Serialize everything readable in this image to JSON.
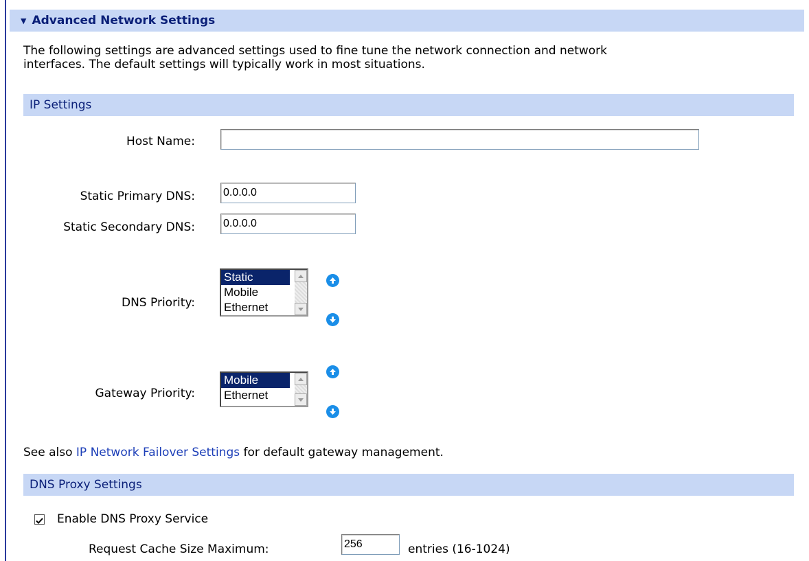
{
  "page": {
    "section_title": "Advanced Network Settings",
    "intro_line1": "The following settings are advanced settings used to fine tune the network connection and network",
    "intro_line2": "interfaces. The default settings will typically work in most situations."
  },
  "ip_settings": {
    "header": "IP Settings",
    "host_name_label": "Host Name:",
    "host_name_value": "",
    "primary_dns_label": "Static Primary DNS:",
    "primary_dns_value": "0.0.0.0",
    "secondary_dns_label": "Static Secondary DNS:",
    "secondary_dns_value": "0.0.0.0",
    "dns_priority_label": "DNS Priority:",
    "dns_priority_options": [
      "Static",
      "Mobile",
      "Ethernet"
    ],
    "dns_priority_selected": "Static",
    "gateway_priority_label": "Gateway Priority:",
    "gateway_priority_options": [
      "Mobile",
      "Ethernet"
    ],
    "gateway_priority_selected": "Mobile",
    "see_also_prefix": "See also ",
    "see_also_link": "IP Network Failover Settings",
    "see_also_suffix": " for default gateway management."
  },
  "dns_proxy": {
    "header": "DNS Proxy Settings",
    "enable_label": "Enable DNS Proxy Service",
    "enable_checked": true,
    "cache_label": "Request Cache Size Maximum:",
    "cache_value": "256",
    "cache_units": "entries (16-1024)"
  },
  "colors": {
    "header_bg": "#c7d7f5",
    "header_text": "#0a1f78",
    "selected_option": "#0a246a",
    "arrow_button": "#1a8ee8",
    "link": "#1d3fb8"
  },
  "icons": {
    "collapse": "triangle-down-icon",
    "move_up": "arrow-up-circle-icon",
    "move_down": "arrow-down-circle-icon"
  }
}
